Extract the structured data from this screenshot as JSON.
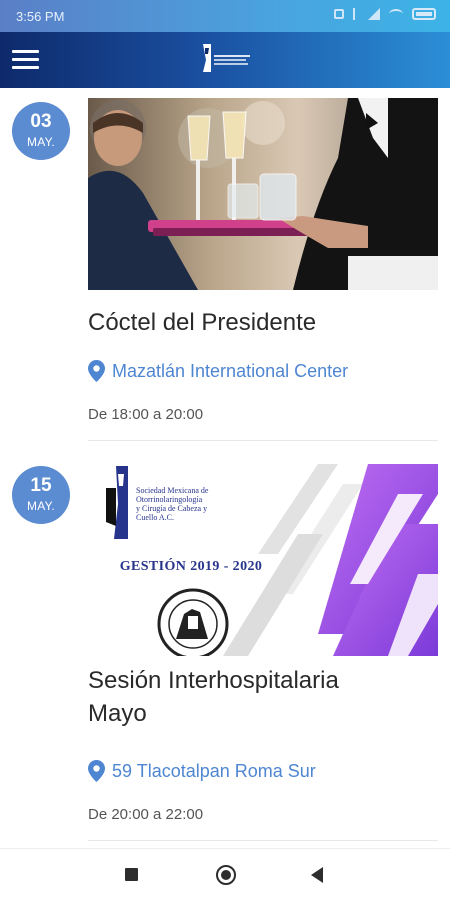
{
  "status_bar": {
    "time": "3:56 PM"
  },
  "app_bar": {
    "menu_icon": "hamburger-menu-icon",
    "logo": "organization-logo"
  },
  "events": [
    {
      "day": "03",
      "month": "MAY.",
      "image": "cocktail-waiter-champagne-photo",
      "title": "Cóctel del Presidente",
      "location": "Mazatlán International Center",
      "time": "De 18:00 a 20:00"
    },
    {
      "day": "15",
      "month": "MAY.",
      "image": "smorl-society-banner",
      "banner": {
        "org_line1": "Sociedad Mexicana de",
        "org_line2": "Otorrinolaringología",
        "org_line3": "y Cirugía de Cabeza y",
        "org_line4": "Cuello A.C.",
        "gestion": "GESTIÓN 2019 - 2020"
      },
      "title_line1": "Sesión Interhospitalaria",
      "title_line2": "Mayo",
      "location": "59 Tlacotalpan Roma Sur",
      "time": "De 20:00 a 22:00"
    }
  ],
  "colors": {
    "app_bar_start": "#0e2a6b",
    "app_bar_end": "#2b8fd6",
    "badge": "#5b8bd0",
    "location_text": "#4e86d2",
    "banner_purple": "#8a3fe0"
  }
}
